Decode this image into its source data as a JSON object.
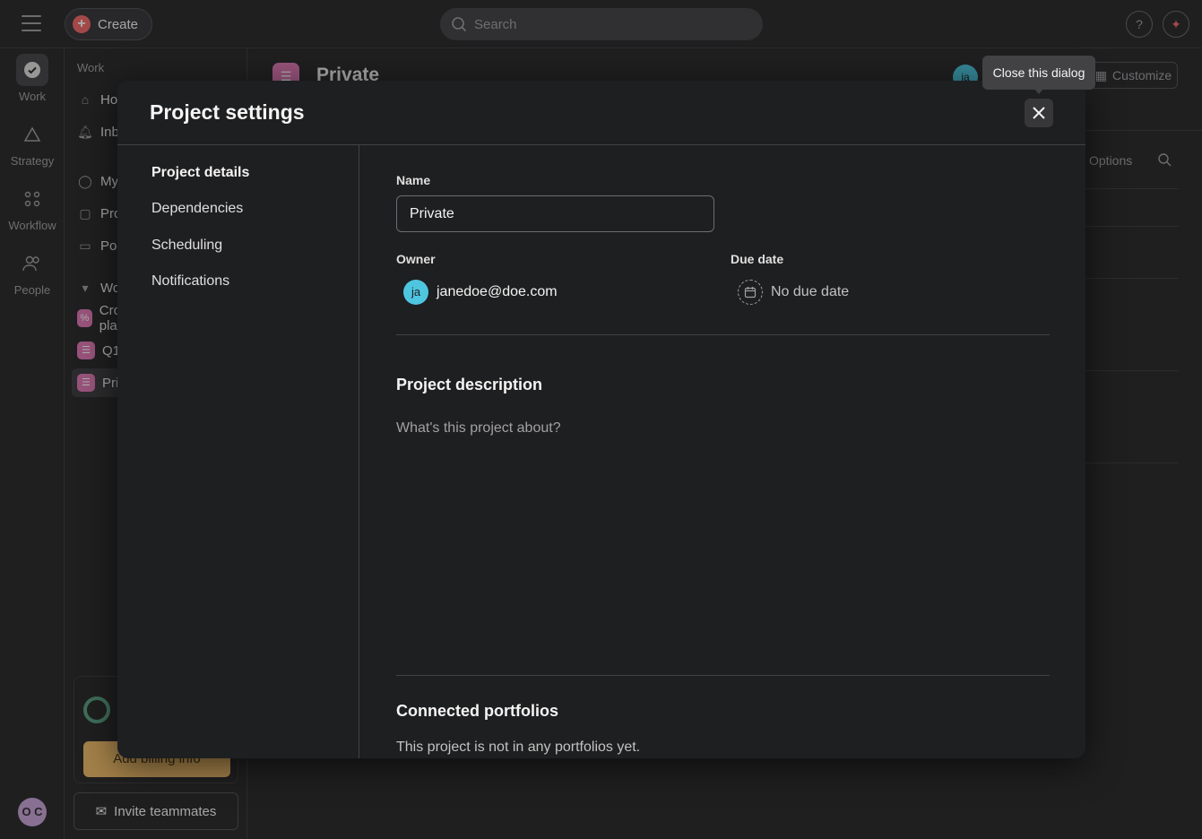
{
  "topbar": {
    "create_label": "Create",
    "search_placeholder": "Search",
    "help_label": "?"
  },
  "rail": {
    "items": [
      {
        "label": "Work"
      },
      {
        "label": "Strategy"
      },
      {
        "label": "Workflow"
      },
      {
        "label": "People"
      }
    ],
    "avatar_initials": "O C"
  },
  "sidebar": {
    "heading": "Work",
    "items": [
      {
        "label": "Home"
      },
      {
        "label": "Inbox"
      },
      {
        "label": "My tasks"
      },
      {
        "label": "Projects"
      },
      {
        "label": "Portfolios"
      }
    ],
    "section_label": "Workspace",
    "projects": [
      {
        "label": "Cross-functional project plan"
      },
      {
        "label": "Q1 planning"
      },
      {
        "label": "Private"
      }
    ],
    "billing_label": "Add billing info",
    "invite_label": "Invite teammates"
  },
  "main": {
    "project_title": "Private",
    "avatar_initials": "ja",
    "customize_label": "Customize",
    "options_label": "Options"
  },
  "dialog": {
    "title": "Project settings",
    "close_tooltip": "Close this dialog",
    "nav": [
      {
        "label": "Project details"
      },
      {
        "label": "Dependencies"
      },
      {
        "label": "Scheduling"
      },
      {
        "label": "Notifications"
      }
    ],
    "name_label": "Name",
    "name_value": "Private",
    "owner_label": "Owner",
    "owner_initials": "ja",
    "owner_email": "janedoe@doe.com",
    "due_label": "Due date",
    "due_value": "No due date",
    "description_title": "Project description",
    "description_placeholder": "What's this project about?",
    "portfolios_title": "Connected portfolios",
    "portfolios_text": "This project is not in any portfolios yet."
  },
  "colors": {
    "accent_red": "#f06a6a",
    "project_pink": "#e07bb5",
    "avatar_blue": "#4ec6e0",
    "billing_yellow": "#f1bd6c",
    "trial_green": "#5da283"
  }
}
